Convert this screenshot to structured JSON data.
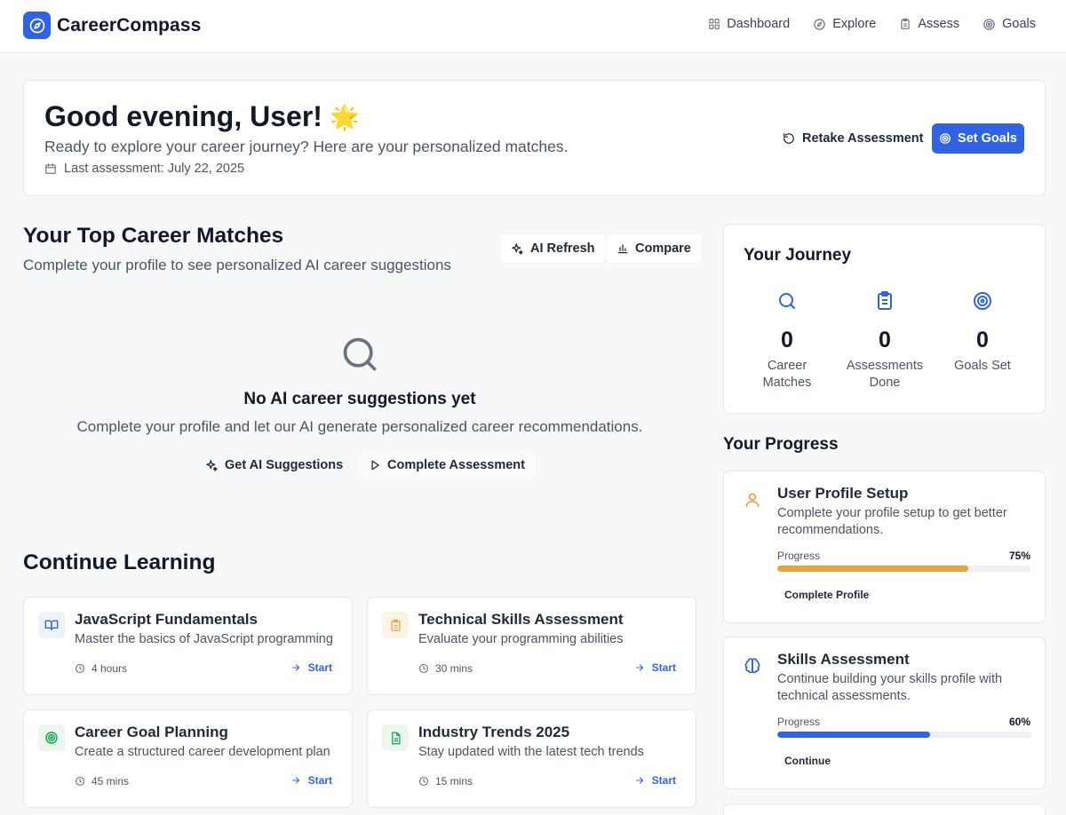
{
  "app": {
    "name": "CareerCompass"
  },
  "nav": {
    "items": [
      {
        "label": "Dashboard",
        "icon": "grid-icon"
      },
      {
        "label": "Explore",
        "icon": "compass-icon"
      },
      {
        "label": "Assess",
        "icon": "clipboard-icon"
      },
      {
        "label": "Goals",
        "icon": "target-icon"
      }
    ]
  },
  "greeting": {
    "title": "Good evening, User!",
    "emoji": "🌟",
    "subtitle": "Ready to explore your career journey? Here are your personalized matches.",
    "last_assessment": "Last assessment: July 22, 2025",
    "retake_label": "Retake Assessment",
    "goals_label": "Set Goals"
  },
  "matches": {
    "title": "Your Top Career Matches",
    "subtitle": "Complete your profile to see personalized AI career suggestions",
    "refresh_label": "AI Refresh",
    "compare_label": "Compare",
    "empty_title": "No AI career suggestions yet",
    "empty_text": "Complete your profile and let our AI generate personalized career recommendations.",
    "get_ai_label": "Get AI Suggestions",
    "complete_label": "Complete Assessment"
  },
  "learning": {
    "title": "Continue Learning",
    "start_label": "Start",
    "items": [
      {
        "title": "JavaScript Fundamentals",
        "desc": "Master the basics of JavaScript programming",
        "duration": "4 hours",
        "icon": "book-icon",
        "color": "#2f63e4",
        "bg": "#eef2fb"
      },
      {
        "title": "Technical Skills Assessment",
        "desc": "Evaluate your programming abilities",
        "duration": "30 mins",
        "icon": "clipboard-icon",
        "color": "#e8a33d",
        "bg": "#fdf4e6"
      },
      {
        "title": "Career Goal Planning",
        "desc": "Create a structured career development plan",
        "duration": "45 mins",
        "icon": "target-icon",
        "color": "#16a34a",
        "bg": "#eaf6ee"
      },
      {
        "title": "Industry Trends 2025",
        "desc": "Stay updated with the latest tech trends",
        "duration": "15 mins",
        "icon": "document-icon",
        "color": "#16a34a",
        "bg": "#eaf6ee"
      }
    ]
  },
  "journey": {
    "title": "Your Journey",
    "stats": [
      {
        "value": "0",
        "label": "Career Matches",
        "icon": "search-icon"
      },
      {
        "value": "0",
        "label": "Assessments Done",
        "icon": "clipboard-icon"
      },
      {
        "value": "0",
        "label": "Goals Set",
        "icon": "target-icon"
      }
    ]
  },
  "progress": {
    "title": "Your Progress",
    "label": "Progress",
    "items": [
      {
        "title": "User Profile Setup",
        "desc": "Complete your profile setup to get better recommendations.",
        "percent": 75,
        "percent_label": "75%",
        "button": "Complete Profile",
        "color": "#e8a33d",
        "icon": "user-icon"
      },
      {
        "title": "Skills Assessment",
        "desc": "Continue building your skills profile with technical assessments.",
        "percent": 60,
        "percent_label": "60%",
        "button": "Continue",
        "color": "#2f63e4",
        "icon": "brain-icon"
      }
    ]
  },
  "colors": {
    "accent": "#2f63e4",
    "warning": "#e8a33d",
    "success": "#16a34a"
  }
}
